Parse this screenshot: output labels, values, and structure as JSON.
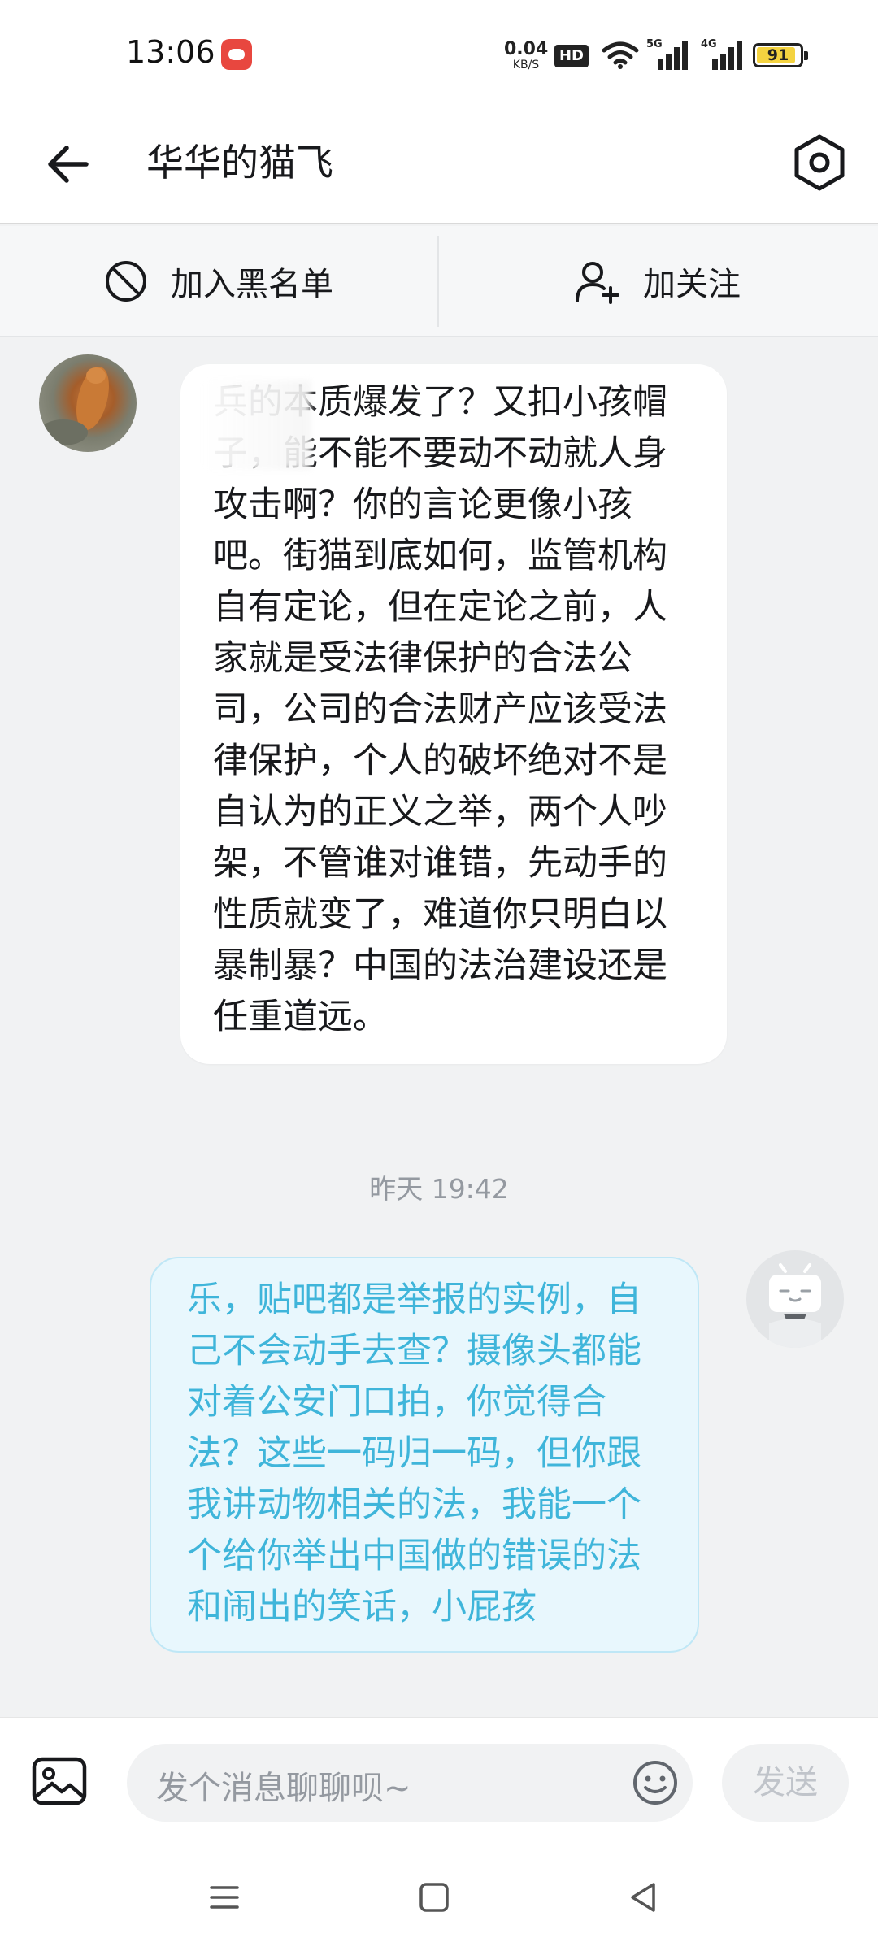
{
  "status_bar": {
    "time": "13:06",
    "net_speed_value": "0.04",
    "net_speed_unit": "KB/S",
    "hd_label": "HD",
    "signal_1": "5G",
    "signal_2": "4G",
    "battery": "91",
    "battery_level": 0.91
  },
  "header": {
    "title": "华华的猫飞",
    "back_icon": "arrow-left-icon",
    "settings_icon": "settings-hexagon-icon"
  },
  "actions": {
    "blacklist_label": "加入黑名单",
    "follow_label": "加关注"
  },
  "messages": [
    {
      "side": "left",
      "text": "兵的本质爆发了？又扣小孩帽子，能不能不要动不动就人身攻击啊？你的言论更像小孩吧。街猫到底如何，监管机构自有定论，但在定论之前，人家就是受法律保护的合法公司，公司的合法财产应该受法律保护，个人的破坏绝对不是自认为的正义之举，两个人吵架，不管谁对谁错，先动手的性质就变了，难道你只明白以暴制暴？中国的法治建设还是任重道远。"
    },
    {
      "side": "right",
      "text": "乐，贴吧都是举报的实例，自己不会动手去查？摄像头都能对着公安门口拍，你觉得合法？这些一码归一码，但你跟我讲动物相关的法，我能一个个给你举出中国做的错误的法和闹出的笑话，小屁孩"
    }
  ],
  "timestamp": "昨天 19:42",
  "input": {
    "placeholder": "发个消息聊聊呗~",
    "send_label": "发送"
  },
  "colors": {
    "accent": "#3fb5da",
    "bubble_right_bg": "#e8f7fd",
    "page_bg": "#f1f2f3"
  }
}
